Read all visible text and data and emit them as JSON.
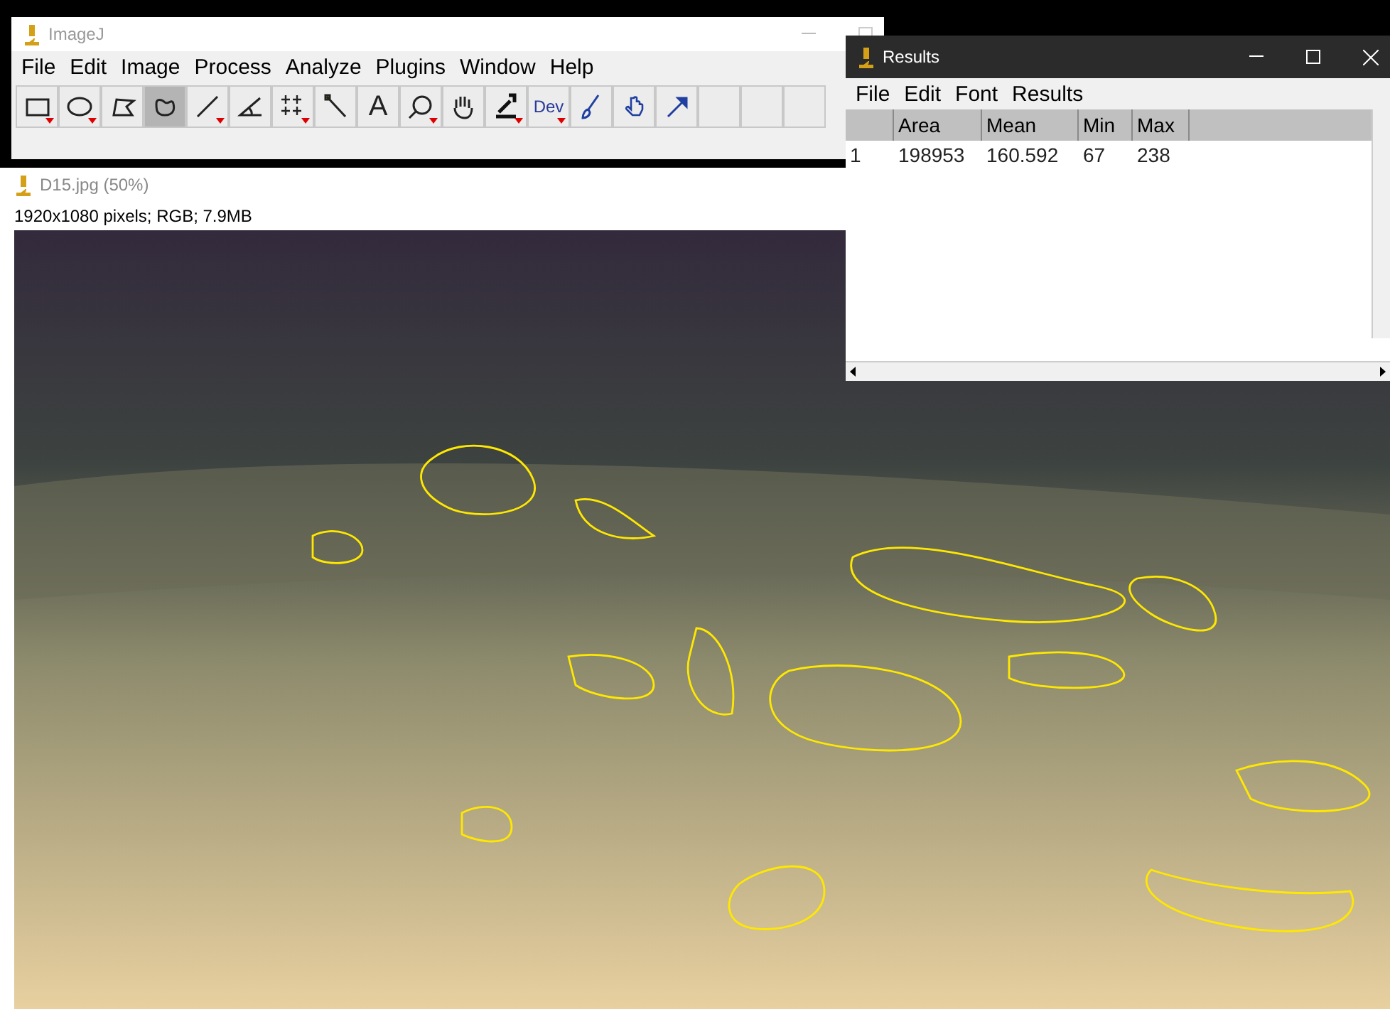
{
  "main_window": {
    "title": "ImageJ",
    "menu": [
      "File",
      "Edit",
      "Image",
      "Process",
      "Analyze",
      "Plugins",
      "Window",
      "Help"
    ],
    "tools": [
      {
        "kind": "icon",
        "selected": false,
        "menu": true
      },
      {
        "kind": "icon",
        "selected": false,
        "menu": true
      },
      {
        "kind": "icon",
        "selected": false,
        "menu": false
      },
      {
        "kind": "icon",
        "selected": true,
        "menu": false
      },
      {
        "kind": "icon",
        "selected": false,
        "menu": true
      },
      {
        "kind": "icon",
        "selected": false,
        "menu": false
      },
      {
        "kind": "icon",
        "selected": false,
        "menu": true
      },
      {
        "kind": "icon",
        "selected": false,
        "menu": false
      },
      {
        "kind": "text",
        "label": "A",
        "selected": false,
        "menu": false
      },
      {
        "kind": "icon",
        "selected": false,
        "menu": true
      },
      {
        "kind": "icon",
        "selected": false,
        "menu": false
      },
      {
        "kind": "icon",
        "selected": false,
        "menu": true
      },
      {
        "kind": "text",
        "label": "Dev",
        "selected": false,
        "menu": true
      },
      {
        "kind": "icon",
        "selected": false,
        "menu": false
      },
      {
        "kind": "icon",
        "selected": false,
        "menu": false
      },
      {
        "kind": "icon",
        "selected": false,
        "menu": false
      },
      {
        "kind": "empty",
        "selected": false,
        "menu": false
      },
      {
        "kind": "empty",
        "selected": false,
        "menu": false
      },
      {
        "kind": "empty",
        "selected": false,
        "menu": false
      }
    ]
  },
  "image_window": {
    "title": "D15.jpg (50%)",
    "info": "1920x1080 pixels; RGB; 7.9MB"
  },
  "results_window": {
    "title": "Results",
    "menu": [
      "File",
      "Edit",
      "Font",
      "Results"
    ],
    "columns": [
      "Area",
      "Mean",
      "Min",
      "Max"
    ],
    "rows": [
      {
        "index": "1",
        "cells": [
          "198953",
          "160.592",
          "67",
          "238"
        ]
      }
    ]
  }
}
